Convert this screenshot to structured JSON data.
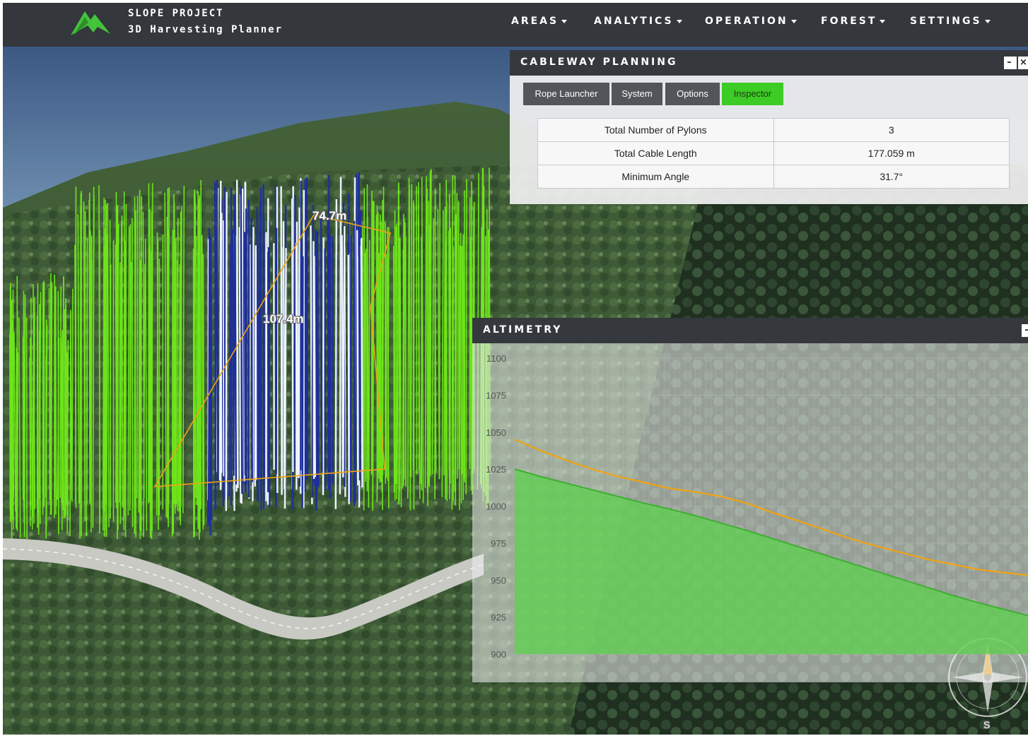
{
  "brand": {
    "title": "SLOPE PROJECT",
    "subtitle": "3D Harvesting Planner"
  },
  "nav": [
    {
      "label": "AREAS"
    },
    {
      "label": "ANALYTICS"
    },
    {
      "label": "OPERATION"
    },
    {
      "label": "FOREST"
    },
    {
      "label": "SETTINGS"
    }
  ],
  "colors": {
    "header": "#35383d",
    "active_tab": "#3dcc26",
    "terrain_fill": "#5dcf4e",
    "cable_line": "#f0a312",
    "tree_stem": "#6ee41a",
    "cut_tree": "#1e2f9a"
  },
  "map_labels": [
    "74.7m",
    "107.4m"
  ],
  "compass": {
    "south": "S"
  },
  "cableway": {
    "title": "CABLEWAY PLANNING",
    "buttons": {
      "minimize": "–",
      "close": "×"
    },
    "tabs": [
      {
        "label": "Rope Launcher",
        "active": false
      },
      {
        "label": "System",
        "active": false
      },
      {
        "label": "Options",
        "active": false
      },
      {
        "label": "Inspector",
        "active": true
      }
    ],
    "inspector": [
      {
        "label": "Total Number of Pylons",
        "value": "3"
      },
      {
        "label": "Total Cable Length",
        "value": "177.059 m"
      },
      {
        "label": "Minimum Angle",
        "value": "31.7°"
      }
    ]
  },
  "altimetry": {
    "title": "ALTIMETRY",
    "buttons": {
      "minimize": "–"
    }
  },
  "chart_data": {
    "type": "area",
    "ylim": [
      900,
      1100
    ],
    "yticks": [
      1100,
      1075,
      1050,
      1025,
      1000,
      975,
      950,
      925,
      900
    ],
    "grid": true,
    "x": [
      0,
      5,
      10,
      15,
      20,
      25,
      30,
      35,
      40,
      45,
      50,
      55,
      60,
      65,
      70,
      75,
      80,
      85,
      90,
      95,
      100
    ],
    "series": [
      {
        "kind": "area",
        "values": [
          1025,
          1020,
          1015.5,
          1011,
          1006.5,
          1002,
          998,
          993.5,
          988.5,
          983.5,
          978,
          972.5,
          967,
          961.5,
          956,
          950.5,
          945,
          939.5,
          934.5,
          930,
          925.5
        ]
      },
      {
        "kind": "line",
        "values": [
          1045,
          1037.5,
          1031,
          1025,
          1020,
          1016,
          1012,
          1009.5,
          1006.5,
          1002,
          995.5,
          990,
          984,
          978,
          973,
          968.5,
          964,
          960.5,
          957,
          955,
          953
        ]
      }
    ]
  }
}
